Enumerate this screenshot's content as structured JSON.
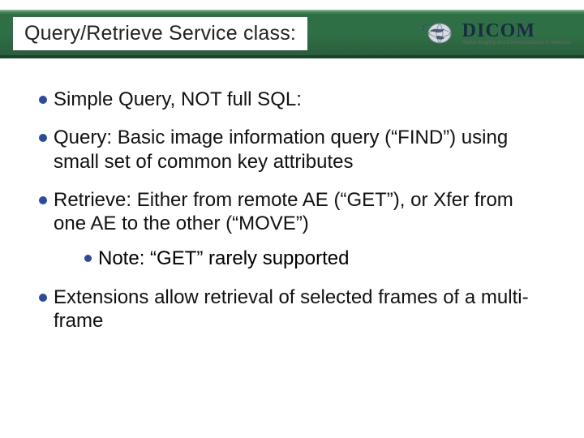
{
  "title": "Query/Retrieve Service class:",
  "logo": {
    "name": "DICOM",
    "tagline": "Digital Imaging and Communications in Medicine"
  },
  "bullets": [
    {
      "text": "Simple Query, NOT full SQL:"
    },
    {
      "text": "Query: Basic image information query (“FIND”) using small set of common key attributes"
    },
    {
      "text": "Retrieve: Either from remote AE (“GET”), or Xfer from one AE to the other (“MOVE”)",
      "sub": [
        {
          "text": "Note: “GET” rarely supported"
        }
      ]
    },
    {
      "text": "Extensions allow retrieval of selected frames of a multi-frame"
    }
  ]
}
